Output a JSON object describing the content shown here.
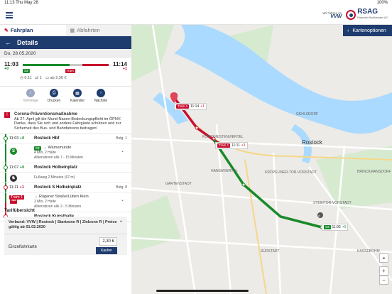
{
  "status": {
    "time": "11:13",
    "date": "Thu May 28",
    "battery": "100%"
  },
  "header": {
    "partner_caption": "Wir fahren im",
    "partner_name": "VVW",
    "brand": "RSAG",
    "brand_sub": "Rostocker Straßenbahn AG"
  },
  "tabs": [
    {
      "label": "Fahrplan",
      "icon": "route-icon"
    },
    {
      "label": "Abfahrten",
      "icon": "departures-icon"
    }
  ],
  "detail": {
    "title": "Details",
    "date": "Do, 28.05.2020",
    "dep_time": "11:03",
    "dep_delay": "+0",
    "arr_time": "11:14",
    "arr_delay": "+1",
    "line_s": "S3",
    "line_tram": "Tram",
    "duration": "0:11",
    "changes": "1",
    "price": "ab 2,30 €"
  },
  "actions": [
    {
      "label": "Vorherige",
      "icon": "previous-icon",
      "enabled": false
    },
    {
      "label": "Drucken",
      "icon": "print-icon",
      "enabled": true
    },
    {
      "label": "Kalender",
      "icon": "calendar-icon",
      "enabled": true
    },
    {
      "label": "Nächste",
      "icon": "next-icon",
      "enabled": true
    }
  ],
  "notice": {
    "title": "Corona-Präventionsmaßnahme",
    "text": "Ab 27. April gilt die Mund-Nasen-Bedeckungspflicht im ÖPNV. Danke, dass Sie sich und andere Fahrgäste schützen und zur Sicherheit des Bus- und Bahnfahrens beitragen!"
  },
  "itinerary": {
    "stop1": {
      "time": "11:03",
      "delay": "+0",
      "name": "Rostock Hbf",
      "platform": "Bstg. 1"
    },
    "leg1": {
      "line": "S3",
      "direction": "→ Warnemünde",
      "details": "4 Min, 2 Halte",
      "alt": "Alternativen alle 7 - 15 Minuten"
    },
    "stop2": {
      "time": "11:07",
      "delay": "+0",
      "name": "Rostock Holbeinplatz"
    },
    "walk": {
      "text": "Fußweg 2 Minuten (67 m)"
    },
    "stop3": {
      "time": "11:11",
      "delay": "+1",
      "name": "Rostock S Holbeinplatz",
      "platform": "Bstg. 8"
    },
    "leg2": {
      "line": "Tram 1",
      "direction": "→ Rügener Straße/Lütten Klein",
      "details": "3 Min, 2 Halte",
      "alt": "Alternativen alle 2 - 5 Minuten"
    },
    "stop4": {
      "time": "11:14",
      "delay": "+1",
      "name": "Rostock Kunsthalle"
    }
  },
  "tarif": {
    "title": "Tarifübersicht",
    "info": "Verbund: VVW | Rostock | Startzone R | Zielzone R | Preise gültig ab 01.02.2020",
    "price": "2,30 €",
    "ticket": "Einzelfahrkarte",
    "buy": "Kaufen"
  },
  "map": {
    "button": "Kartenoptionen",
    "labels": {
      "rostock": "Rostock",
      "gehlsdorf": "GEHLSDORF",
      "komponistenviertel": "KOMPONISTENVIERTEL",
      "hansaviertel": "HANSAVIERTEL",
      "gartenstadt": "GARTENSTADT",
      "kroepeliner": "KRÖPELINER-TOR-VORSTADT",
      "brinckmansdorf": "BRINCKMANSDORF",
      "steintor": "STEINTOR-VORSTADT",
      "suedstadt": "SÜDSTADT",
      "kassebohm": "KASSEBOHM"
    },
    "tram_label_1": "Tram 1",
    "tram_time_1": "11:14",
    "tram_delay_1": "+1",
    "tram_label_2": "Tram 1",
    "tram_time_2": "11:11",
    "tram_delay_2": "+1",
    "s_label": "S3",
    "s_time": "11:03",
    "s_delay": "+0",
    "marker_b": "B",
    "marker_a": "A"
  },
  "colors": {
    "primary": "#1e3c6e",
    "tram": "#c8102e",
    "sbahn": "#1a8a2a",
    "water": "#aadaff"
  }
}
